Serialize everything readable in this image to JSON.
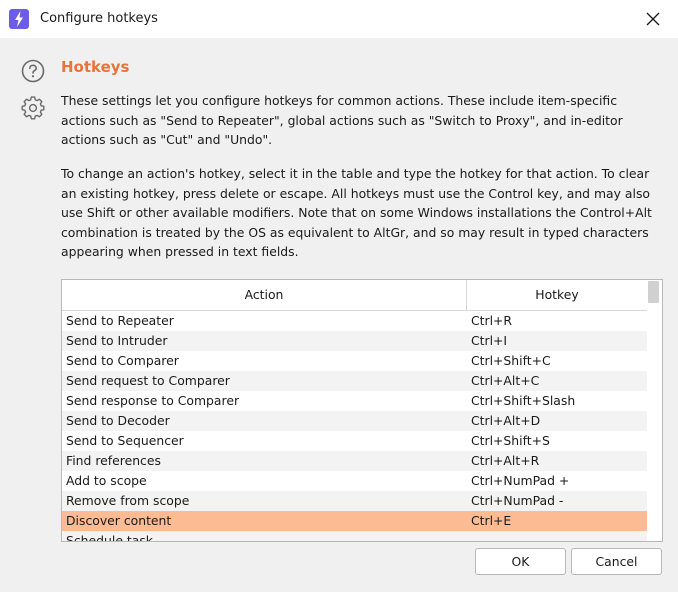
{
  "window": {
    "title": "Configure hotkeys",
    "app_icon": "lightning-bolt-icon",
    "close_icon": "close-icon"
  },
  "sidebar_icons": [
    "help-circle-icon",
    "gear-icon"
  ],
  "section": {
    "heading": "Hotkeys",
    "paragraph1": "These settings let you configure hotkeys for common actions. These include item-specific actions such as \"Send to Repeater\", global actions such as \"Switch to Proxy\", and in-editor actions such as \"Cut\" and \"Undo\".",
    "paragraph2": "To change an action's hotkey, select it in the table and type the hotkey for that action. To clear an existing hotkey, press delete or escape. All hotkeys must use the Control key, and may also use Shift or other available modifiers. Note that on some Windows installations the Control+Alt combination is treated by the OS as equivalent to AltGr, and so may result in typed characters appearing when pressed in text fields."
  },
  "table": {
    "columns": [
      "Action",
      "Hotkey"
    ],
    "rows": [
      {
        "action": "Send to Repeater",
        "hotkey": "Ctrl+R"
      },
      {
        "action": "Send to Intruder",
        "hotkey": "Ctrl+I"
      },
      {
        "action": "Send to Comparer",
        "hotkey": "Ctrl+Shift+C"
      },
      {
        "action": "Send request to Comparer",
        "hotkey": "Ctrl+Alt+C"
      },
      {
        "action": "Send response to Comparer",
        "hotkey": "Ctrl+Shift+Slash"
      },
      {
        "action": "Send to Decoder",
        "hotkey": "Ctrl+Alt+D"
      },
      {
        "action": "Send to Sequencer",
        "hotkey": "Ctrl+Shift+S"
      },
      {
        "action": "Find references",
        "hotkey": "Ctrl+Alt+R"
      },
      {
        "action": "Add to scope",
        "hotkey": "Ctrl+NumPad +"
      },
      {
        "action": "Remove from scope",
        "hotkey": "Ctrl+NumPad -"
      },
      {
        "action": "Discover content",
        "hotkey": "Ctrl+E",
        "selected": true
      },
      {
        "action": "Schedule task",
        "hotkey": ""
      }
    ]
  },
  "buttons": {
    "ok": "OK",
    "cancel": "Cancel"
  },
  "colors": {
    "accent": "#e8743b",
    "selected_row": "#fdbb93",
    "app_icon_bg": "#6c5ce7"
  }
}
